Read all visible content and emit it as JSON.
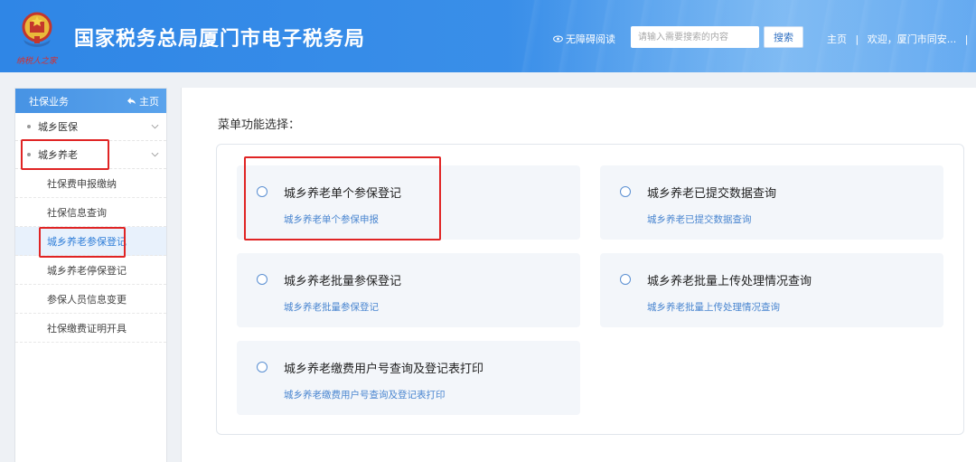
{
  "header": {
    "site_title": "国家税务总局厦门市电子税务局",
    "emblem_caption": "纳税人之家",
    "accessibility_label": "无障碍阅读",
    "search_placeholder": "请输入需要搜索的内容",
    "search_button": "搜索",
    "home_link": "主页",
    "separator": "|",
    "welcome_text": "欢迎，厦门市同安...",
    "separator2": "|",
    "colors": {
      "header_blue": "#2f86e6",
      "accent": "#2f7ed8",
      "highlight_red": "#e02424"
    }
  },
  "sidebar": {
    "section_title": "社保业务",
    "home_label": "主页",
    "groups": [
      {
        "label": "城乡医保",
        "expanded": false
      },
      {
        "label": "城乡养老",
        "expanded": true
      }
    ],
    "sub_items": [
      {
        "label": "社保费申报缴纳"
      },
      {
        "label": "社保信息查询"
      },
      {
        "label": "城乡养老参保登记",
        "active": true
      },
      {
        "label": "城乡养老停保登记"
      },
      {
        "label": "参保人员信息变更"
      },
      {
        "label": "社保缴费证明开具"
      }
    ]
  },
  "main": {
    "menu_label": "菜单功能选择：",
    "cards": [
      {
        "title": "城乡养老单个参保登记",
        "subtitle": "城乡养老单个参保申报",
        "highlighted": true
      },
      {
        "title": "城乡养老已提交数据查询",
        "subtitle": "城乡养老已提交数据查询"
      },
      {
        "title": "城乡养老批量参保登记",
        "subtitle": "城乡养老批量参保登记"
      },
      {
        "title": "城乡养老批量上传处理情况查询",
        "subtitle": "城乡养老批量上传处理情况查询"
      },
      {
        "title": "城乡养老缴费用户号查询及登记表打印",
        "subtitle": "城乡养老缴费用户号查询及登记表打印"
      }
    ]
  }
}
